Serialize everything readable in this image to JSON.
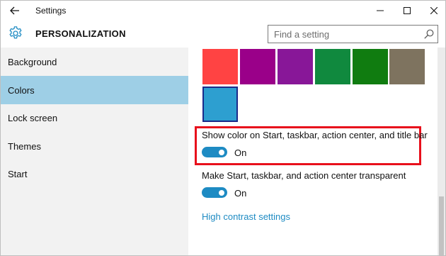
{
  "window": {
    "title": "Settings"
  },
  "header": {
    "page_title": "PERSONALIZATION",
    "search_placeholder": "Find a setting"
  },
  "sidebar": {
    "items": [
      {
        "label": "Background",
        "selected": false
      },
      {
        "label": "Colors",
        "selected": true
      },
      {
        "label": "Lock screen",
        "selected": false
      },
      {
        "label": "Themes",
        "selected": false
      },
      {
        "label": "Start",
        "selected": false
      }
    ]
  },
  "colors": {
    "accent_swatches": [
      "#ff4343",
      "#9a0089",
      "#881798",
      "#10893e",
      "#107c10",
      "#7e735f",
      "#2d9fd0"
    ],
    "selected_swatch": "#2d9fd0",
    "selection_border": "#1b2a8a",
    "toggle_on": "#1e8bc3",
    "sidebar_selected": "#9ecfe6",
    "highlight_box": "#e8101c"
  },
  "settings": {
    "show_color": {
      "label": "Show color on Start, taskbar, action center, and title bar",
      "state": "On"
    },
    "transparent": {
      "label": "Make Start, taskbar, and action center transparent",
      "state": "On"
    },
    "high_contrast_link": "High contrast settings"
  },
  "icons": {
    "back": "back-arrow-icon",
    "minimize": "minimize-icon",
    "maximize": "maximize-icon",
    "close": "close-icon",
    "settings": "gear-icon",
    "search": "search-icon"
  }
}
